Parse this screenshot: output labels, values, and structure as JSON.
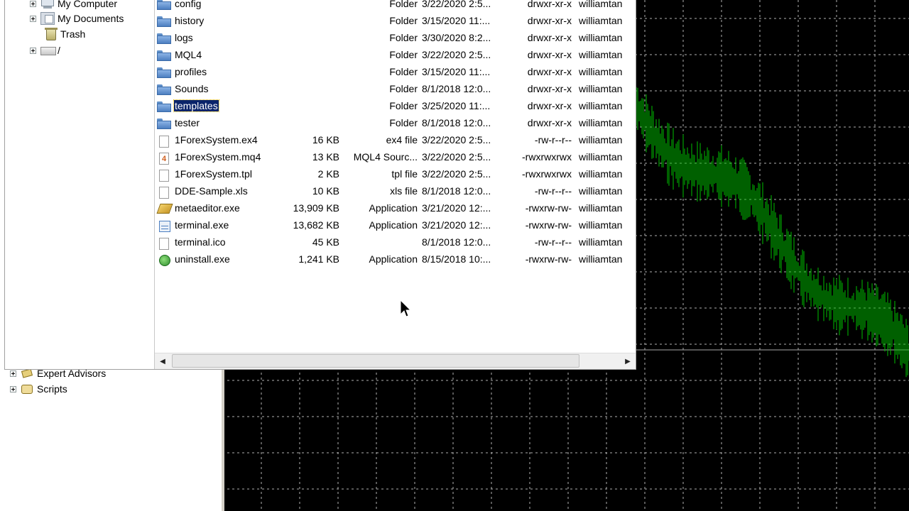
{
  "navigator": {
    "items": [
      {
        "label": "Expert Advisors"
      },
      {
        "label": "Scripts"
      }
    ]
  },
  "tree": {
    "items": [
      {
        "label": "My Computer"
      },
      {
        "label": "My Documents"
      },
      {
        "label": "Trash"
      },
      {
        "label": "/"
      }
    ]
  },
  "files": [
    {
      "name": "config",
      "size": "",
      "type": "Folder",
      "date": "3/22/2020 2:5...",
      "perm": "drwxr-xr-x",
      "owner": "williamtan",
      "icon": "folder-icon"
    },
    {
      "name": "history",
      "size": "",
      "type": "Folder",
      "date": "3/15/2020 11:...",
      "perm": "drwxr-xr-x",
      "owner": "williamtan",
      "icon": "folder-icon"
    },
    {
      "name": "logs",
      "size": "",
      "type": "Folder",
      "date": "3/30/2020 8:2...",
      "perm": "drwxr-xr-x",
      "owner": "williamtan",
      "icon": "folder-icon"
    },
    {
      "name": "MQL4",
      "size": "",
      "type": "Folder",
      "date": "3/22/2020 2:5...",
      "perm": "drwxr-xr-x",
      "owner": "williamtan",
      "icon": "folder-icon"
    },
    {
      "name": "profiles",
      "size": "",
      "type": "Folder",
      "date": "3/15/2020 11:...",
      "perm": "drwxr-xr-x",
      "owner": "williamtan",
      "icon": "folder-icon"
    },
    {
      "name": "Sounds",
      "size": "",
      "type": "Folder",
      "date": "8/1/2018 12:0...",
      "perm": "drwxr-xr-x",
      "owner": "williamtan",
      "icon": "folder-icon"
    },
    {
      "name": "templates",
      "size": "",
      "type": "Folder",
      "date": "3/25/2020 11:...",
      "perm": "drwxr-xr-x",
      "owner": "williamtan",
      "icon": "folder-icon",
      "selected": true
    },
    {
      "name": "tester",
      "size": "",
      "type": "Folder",
      "date": "8/1/2018 12:0...",
      "perm": "drwxr-xr-x",
      "owner": "williamtan",
      "icon": "folder-icon"
    },
    {
      "name": "1ForexSystem.ex4",
      "size": "16 KB",
      "type": "ex4 file",
      "date": "3/22/2020 2:5...",
      "perm": "-rw-r--r--",
      "owner": "williamtan",
      "icon": "doc-icon"
    },
    {
      "name": "1ForexSystem.mq4",
      "size": "13 KB",
      "type": "MQL4 Sourc...",
      "date": "3/22/2020 2:5...",
      "perm": "-rwxrwxrwx",
      "owner": "williamtan",
      "icon": "mq4-icon"
    },
    {
      "name": "1ForexSystem.tpl",
      "size": "2 KB",
      "type": "tpl file",
      "date": "3/22/2020 2:5...",
      "perm": "-rwxrwxrwx",
      "owner": "williamtan",
      "icon": "doc-icon"
    },
    {
      "name": "DDE-Sample.xls",
      "size": "10 KB",
      "type": "xls file",
      "date": "8/1/2018 12:0...",
      "perm": "-rw-r--r--",
      "owner": "williamtan",
      "icon": "doc-icon"
    },
    {
      "name": "metaeditor.exe",
      "size": "13,909 KB",
      "type": "Application",
      "date": "3/21/2020 12:...",
      "perm": "-rwxrw-rw-",
      "owner": "williamtan",
      "icon": "metaeditor-icon"
    },
    {
      "name": "terminal.exe",
      "size": "13,682 KB",
      "type": "Application",
      "date": "3/21/2020 12:...",
      "perm": "-rwxrw-rw-",
      "owner": "williamtan",
      "icon": "terminal-icon"
    },
    {
      "name": "terminal.ico",
      "size": "45 KB",
      "type": "",
      "date": "8/1/2018 12:0...",
      "perm": "-rw-r--r--",
      "owner": "williamtan",
      "icon": "doc-icon"
    },
    {
      "name": "uninstall.exe",
      "size": "1,241 KB",
      "type": "Application",
      "date": "8/15/2018 10:...",
      "perm": "-rwxrw-rw-",
      "owner": "williamtan",
      "icon": "uninstall-icon"
    }
  ],
  "scrollbar": {
    "left_arrow": "◀",
    "right_arrow": "▶"
  },
  "colors": {
    "selection": "#0a246a",
    "chart_line": "#00c000",
    "chart_bg": "#000000",
    "grid": "#b0b0b0"
  }
}
